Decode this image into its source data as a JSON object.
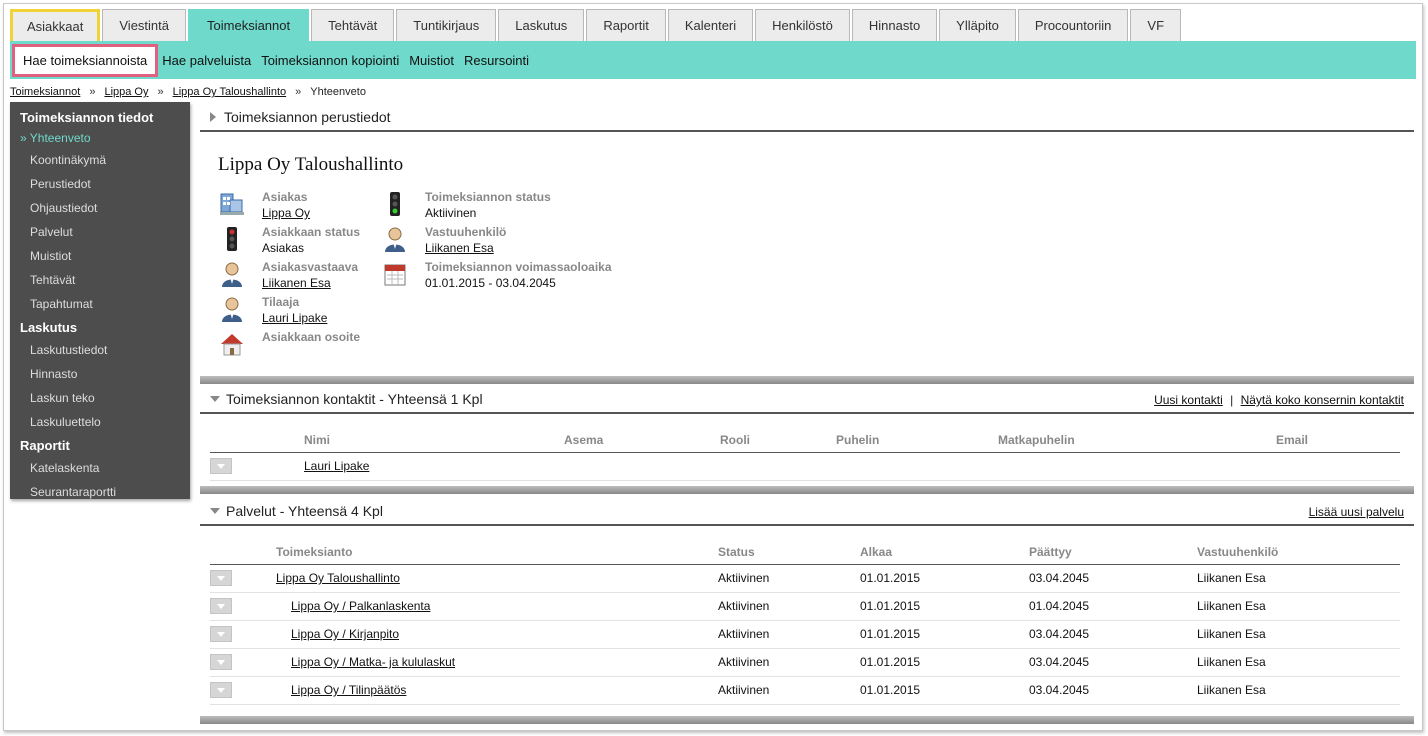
{
  "topnav": {
    "tabs": [
      "Asiakkaat",
      "Viestintä",
      "Toimeksiannot",
      "Tehtävät",
      "Tuntikirjaus",
      "Laskutus",
      "Raportit",
      "Kalenteri",
      "Henkilöstö",
      "Hinnasto",
      "Ylläpito",
      "Procountoriin",
      "VF"
    ],
    "active_index": 2
  },
  "subnav": {
    "items": [
      "Hae toimeksiannoista",
      "Hae palveluista",
      "Toimeksiannon kopiointi",
      "Muistiot",
      "Resursointi"
    ]
  },
  "breadcrumb": {
    "items": [
      "Toimeksiannot",
      "Lippa Oy",
      "Lippa Oy Taloushallinto"
    ],
    "current": "Yhteenveto",
    "separator": "»"
  },
  "sidebar": {
    "section1": "Toimeksiannon tiedot",
    "current_item": "» Yhteenveto",
    "items1": [
      "Koontinäkymä",
      "Perustiedot",
      "Ohjaustiedot",
      "Palvelut",
      "Muistiot",
      "Tehtävät",
      "Tapahtumat"
    ],
    "section2": "Laskutus",
    "items2": [
      "Laskutustiedot",
      "Hinnasto",
      "Laskun teko",
      "Laskuluettelo"
    ],
    "section3": "Raportit",
    "items3": [
      "Katelaskenta",
      "Seurantaraportti"
    ]
  },
  "basics": {
    "header": "Toimeksiannon perustiedot",
    "title": "Lippa Oy Taloushallinto",
    "asiakas_label": "Asiakas",
    "asiakas_value": "Lippa Oy",
    "asiakkaan_status_label": "Asiakkaan status",
    "asiakkaan_status_value": "Asiakas",
    "asiakasvastaava_label": "Asiakasvastaava",
    "asiakasvastaava_value": "Liikanen Esa",
    "tilaaja_label": "Tilaaja",
    "tilaaja_value": "Lauri Lipake",
    "osoite_label": "Asiakkaan osoite",
    "status_label": "Toimeksiannon status",
    "status_value": "Aktiivinen",
    "vastuuhenkilo_label": "Vastuuhenkilö",
    "vastuuhenkilo_value": "Liikanen Esa",
    "voimassa_label": "Toimeksiannon voimassaoloaika",
    "voimassa_value": "01.01.2015 - 03.04.2045"
  },
  "contacts": {
    "header": "Toimeksiannon kontaktit - Yhteensä 1 Kpl",
    "link_new": "Uusi kontakti",
    "link_sep": "|",
    "link_all": "Näytä koko konsernin kontaktit",
    "columns": [
      "Nimi",
      "Asema",
      "Rooli",
      "Puhelin",
      "Matkapuhelin",
      "Email"
    ],
    "rows": [
      {
        "name": "Lauri Lipake"
      }
    ]
  },
  "services": {
    "header": "Palvelut - Yhteensä 4 Kpl",
    "link_add": "Lisää uusi palvelu",
    "columns": [
      "Toimeksianto",
      "Status",
      "Alkaa",
      "Päättyy",
      "Vastuuhenkilö"
    ],
    "rows": [
      {
        "name": "Lippa Oy Taloushallinto",
        "status": "Aktiivinen",
        "start": "01.01.2015",
        "end": "03.04.2045",
        "owner": "Liikanen Esa"
      },
      {
        "name": "Lippa Oy / Palkanlaskenta",
        "status": "Aktiivinen",
        "start": "01.01.2015",
        "end": "01.04.2045",
        "owner": "Liikanen Esa"
      },
      {
        "name": "Lippa Oy / Kirjanpito",
        "status": "Aktiivinen",
        "start": "01.01.2015",
        "end": "03.04.2045",
        "owner": "Liikanen Esa"
      },
      {
        "name": "Lippa Oy / Matka- ja kululaskut",
        "status": "Aktiivinen",
        "start": "01.01.2015",
        "end": "03.04.2045",
        "owner": "Liikanen Esa"
      },
      {
        "name": "Lippa Oy / Tilinpäätös",
        "status": "Aktiivinen",
        "start": "01.01.2015",
        "end": "03.04.2045",
        "owner": "Liikanen Esa"
      }
    ]
  },
  "colors": {
    "accent": "#6fd9cb",
    "sidebar_bg": "#4d4d4d",
    "highlight_yellow": "#f0d437",
    "highlight_pink": "#e0607f"
  }
}
